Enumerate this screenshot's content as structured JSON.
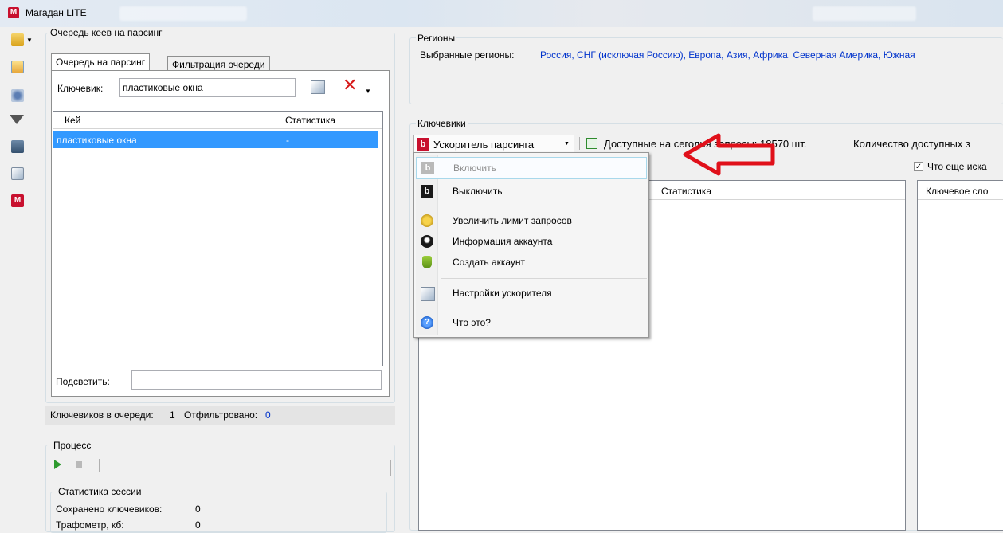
{
  "window": {
    "title": "Магадан LITE",
    "logo": "М"
  },
  "left_panel": {
    "group_label": "Очередь кеев на парсинг",
    "tabs": [
      {
        "label": "Очередь на парсинг",
        "active": true
      },
      {
        "label": "Фильтрация очереди",
        "active": false
      }
    ],
    "keyword_label": "Ключевик:",
    "keyword_value": "пластиковые окна",
    "table": {
      "columns": [
        "Кей",
        "Статистика"
      ],
      "rows": [
        {
          "key": "пластиковые окна",
          "stat": "-"
        }
      ]
    },
    "highlight_label": "Подсветить:",
    "highlight_value": "",
    "status": {
      "in_queue_label": "Ключевиков в очереди:",
      "in_queue_value": "1",
      "filtered_label": "Отфильтровано:",
      "filtered_value": "0"
    }
  },
  "process": {
    "group_label": "Процесс",
    "session_label": "Статистика сессии",
    "saved_label": "Сохранено ключевиков:",
    "saved_value": "0",
    "traffic_label": "Трафометр, кб:",
    "traffic_value": "0"
  },
  "regions": {
    "group_label": "Регионы",
    "selected_label": "Выбранные регионы:",
    "selected_value": "Россия, СНГ (исключая Россию), Европа, Азия, Африка, Северная Америка, Южная"
  },
  "keywords": {
    "group_label": "Ключевики",
    "accelerator_label": "Ускоритель парсинга",
    "available_label": "Доступные на сегодня запросы: 18570 шт.",
    "count_label": "Количество доступных з",
    "also_search_label": "Что еще иска",
    "also_search_checked": true,
    "columns": [
      "Статистика",
      "Ключевое сло"
    ]
  },
  "menu": {
    "items": [
      {
        "label": "Включить",
        "icon": "accelerator-on-icon",
        "disabled": true
      },
      {
        "label": "Выключить",
        "icon": "accelerator-off-icon",
        "disabled": false
      },
      {
        "label": "Увеличить лимит запросов",
        "icon": "coins-icon",
        "disabled": false
      },
      {
        "label": "Информация аккаунта",
        "icon": "account-info-icon",
        "disabled": false
      },
      {
        "label": "Создать аккаунт",
        "icon": "create-account-icon",
        "disabled": false
      },
      {
        "label": "Настройки ускорителя",
        "icon": "settings-icon",
        "disabled": false
      },
      {
        "label": "Что это?",
        "icon": "help-icon",
        "disabled": false
      }
    ]
  },
  "colors": {
    "accent": "#c8102e",
    "selection": "#3399ff",
    "link": "#0033cc",
    "arrow": "#e0101a"
  }
}
